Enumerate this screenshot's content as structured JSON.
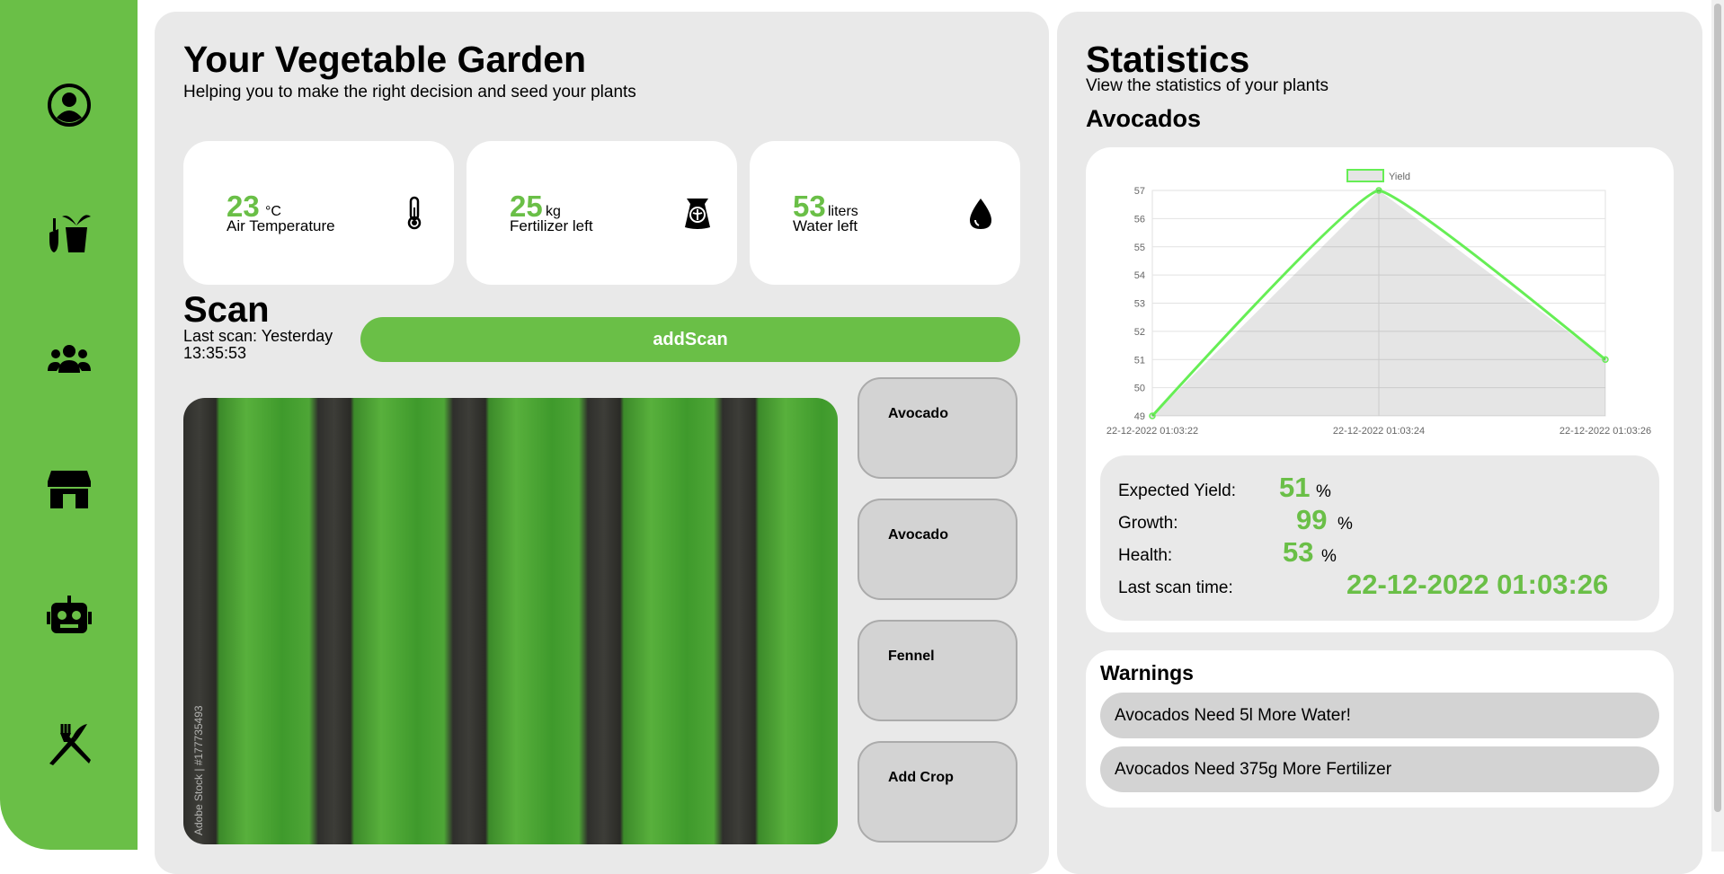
{
  "sidebar": {
    "icons": [
      "user-circle-icon",
      "gardening-tools-icon",
      "people-icon",
      "store-icon",
      "robot-icon",
      "utensils-icon"
    ]
  },
  "garden": {
    "title": "Your Vegetable Garden",
    "subtitle": "Helping you to make the right decision and seed your plants",
    "cards": [
      {
        "value": "23",
        "unit": "°C",
        "label": "Air Temperature",
        "icon": "thermometer-icon"
      },
      {
        "value": "25",
        "unit": "kg",
        "label": "Fertilizer left",
        "icon": "fertilizer-bag-icon"
      },
      {
        "value": "53",
        "unit": "liters",
        "label": "Water left",
        "icon": "water-drop-icon"
      }
    ]
  },
  "scan": {
    "title": "Scan",
    "last_scan": "Last scan: Yesterday 13:35:53",
    "add_button": "addScan",
    "image_watermark": "Adobe Stock | #177735493",
    "crops": [
      "Avocado",
      "Avocado",
      "Fennel",
      "Add Crop"
    ]
  },
  "statistics": {
    "title": "Statistics",
    "subtitle": "View the statistics of your plants",
    "plant": "Avocados",
    "expected_yield_label": "Expected Yield:",
    "expected_yield_value": "51",
    "growth_label": "Growth:",
    "growth_value": "99",
    "health_label": "Health:",
    "health_value": "53",
    "percent": "%",
    "last_scan_label": "Last scan time:",
    "last_scan_value": "22-12-2022 01:03:26"
  },
  "warnings": {
    "title": "Warnings",
    "items": [
      "Avocados Need 5l More Water!",
      "Avocados Need 375g More Fertilizer"
    ]
  },
  "colors": {
    "accent": "#6abf47",
    "line": "#66ee55"
  },
  "chart_data": {
    "type": "area",
    "x": [
      "22-12-2022 01:03:22",
      "22-12-2022 01:03:24",
      "22-12-2022 01:03:26"
    ],
    "series": [
      {
        "name": "Yield",
        "values": [
          49,
          57,
          51
        ]
      }
    ],
    "yticks": [
      49,
      50,
      51,
      52,
      53,
      54,
      55,
      56,
      57
    ],
    "ylim": [
      49,
      57
    ],
    "grid": true,
    "legend": "top-center"
  }
}
